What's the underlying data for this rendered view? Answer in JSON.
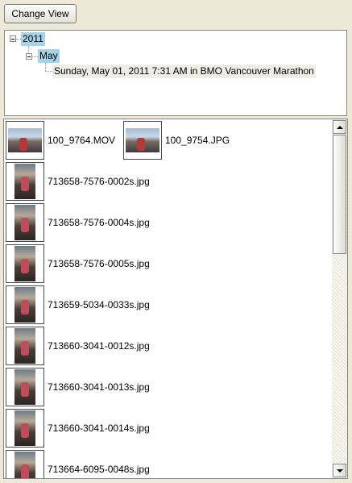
{
  "toolbar": {
    "change_view_label": "Change View"
  },
  "tree": {
    "year": "2011",
    "month": "May",
    "event": "Sunday, May 01, 2011 7:31 AM in BMO Vancouver Marathon"
  },
  "list": {
    "first_row": [
      {
        "name": "100_9764.MOV",
        "icon": "video-thumbnail-icon"
      },
      {
        "name": "100_9754.JPG",
        "icon": "photo-thumbnail-icon"
      }
    ],
    "items": [
      {
        "name": "713658-7576-0002s.jpg",
        "icon": "photo-thumbnail-icon"
      },
      {
        "name": "713658-7576-0004s.jpg",
        "icon": "photo-thumbnail-icon"
      },
      {
        "name": "713658-7576-0005s.jpg",
        "icon": "photo-thumbnail-icon"
      },
      {
        "name": "713659-5034-0033s.jpg",
        "icon": "photo-thumbnail-icon"
      },
      {
        "name": "713660-3041-0012s.jpg",
        "icon": "photo-thumbnail-icon"
      },
      {
        "name": "713660-3041-0013s.jpg",
        "icon": "photo-thumbnail-icon"
      },
      {
        "name": "713660-3041-0014s.jpg",
        "icon": "photo-thumbnail-icon"
      },
      {
        "name": "713664-6095-0048s.jpg",
        "icon": "photo-thumbnail-icon"
      }
    ]
  },
  "colors": {
    "selection": "#a6d3e7",
    "background": "#ece9d8"
  }
}
